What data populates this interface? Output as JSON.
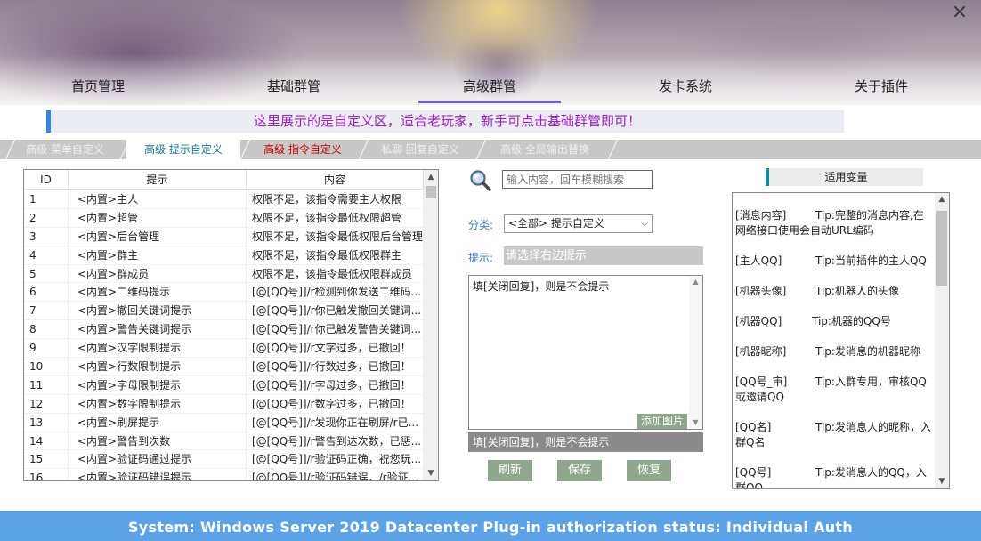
{
  "header": {
    "close_label": "×",
    "nav": [
      "首页管理",
      "基础群管",
      "高级群管",
      "发卡系统",
      "关于插件"
    ],
    "active_nav": 2
  },
  "notice": "这里展示的是自定义区，适合老玩家，新手可点击基础群管即可！",
  "subtabs": [
    "高级 菜单自定义",
    "高级 提示自定义",
    "高级 指令自定义",
    "私聊 回复自定义",
    "高级 全局输出替换"
  ],
  "table": {
    "headers": [
      "ID",
      "提示",
      "内容"
    ],
    "rows": [
      [
        "1",
        "<内置>主人",
        "权限不足，该指令需要主人权限"
      ],
      [
        "2",
        "<内置>超管",
        "权限不足，该指令最低权限超管"
      ],
      [
        "3",
        "<内置>后台管理",
        "权限不足，该指令最低权限后台管理"
      ],
      [
        "4",
        "<内置>群主",
        "权限不足，该指令最低权限群主"
      ],
      [
        "5",
        "<内置>群成员",
        "权限不足，该指令最低权限群成员"
      ],
      [
        "6",
        "<内置>二维码提示",
        "[@[QQ号]]/r检测到你发送二维码..."
      ],
      [
        "7",
        "<内置>撤回关键词提示",
        "[@[QQ号]]/r你已触发撤回关键词..."
      ],
      [
        "8",
        "<内置>警告关键词提示",
        "[@[QQ号]]/r你已触发警告关键词..."
      ],
      [
        "9",
        "<内置>汉字限制提示",
        "[@[QQ号]]/r文字过多，已撤回！"
      ],
      [
        "10",
        "<内置>行数限制提示",
        "[@[QQ号]]/r行数过多，已撤回！"
      ],
      [
        "11",
        "<内置>字母限制提示",
        "[@[QQ号]]/r字母过多，已撤回！"
      ],
      [
        "12",
        "<内置>数字限制提示",
        "[@[QQ号]]/r数字过多，已撤回！"
      ],
      [
        "13",
        "<内置>刷屏提示",
        "[@[QQ号]]/r发现你正在刷屏/r已..."
      ],
      [
        "14",
        "<内置>警告到次数",
        "[@[QQ号]]/r警告到达次数，已惩..."
      ],
      [
        "15",
        "<内置>验证码通过提示",
        "[@[QQ号]]/r验证码正确，祝您玩..."
      ],
      [
        "16",
        "<内置>验证码错误提示",
        "[@[QQ号]]/r验证码错误，/r验证..."
      ]
    ]
  },
  "search": {
    "placeholder": "输入内容，回车模糊搜索"
  },
  "category": {
    "label": "分类:",
    "selected": "<全部> 提示自定义"
  },
  "tip": {
    "label": "提示:",
    "value": "请选择右边提示"
  },
  "editor": {
    "text": "填[关闭回复]，则是不会提示",
    "add_image": "添加图片",
    "preview": "填[关闭回复]，则是不会提示"
  },
  "buttons": {
    "refresh": "刷新",
    "save": "保存",
    "restore": "恢复"
  },
  "variables": {
    "title": "适用变量",
    "items": [
      {
        "key": "[消息内容]",
        "tip": "Tip:完整的消息内容,在网络接口使用会自动URL编码"
      },
      {
        "key": "[主人QQ]",
        "tip": "Tip:当前插件的主人QQ"
      },
      {
        "key": "[机器头像]",
        "tip": "Tip:机器人的头像"
      },
      {
        "key": "[机器QQ]",
        "tip": "Tip:机器的QQ号"
      },
      {
        "key": "[机器昵称]",
        "tip": "Tip:发消息的机器昵称"
      },
      {
        "key": "[QQ号_审]",
        "tip": "Tip:入群专用，审核QQ或邀请QQ"
      },
      {
        "key": "[QQ名]",
        "tip": "Tip:发消息人的昵称，入群Q名"
      },
      {
        "key": "[QQ号]",
        "tip": "Tip:发消息人的QQ，入群QQ"
      }
    ]
  },
  "footer": "System:  Windows Server 2019 Datacenter  Plug-in authorization status:  Individual Auth",
  "colors": {
    "accent": "#5ba3e6",
    "notice_text": "#a020c8",
    "button": "#8fa78c",
    "active_tab_text": "#1a7a9a",
    "alert_tab_text": "#d00000"
  }
}
